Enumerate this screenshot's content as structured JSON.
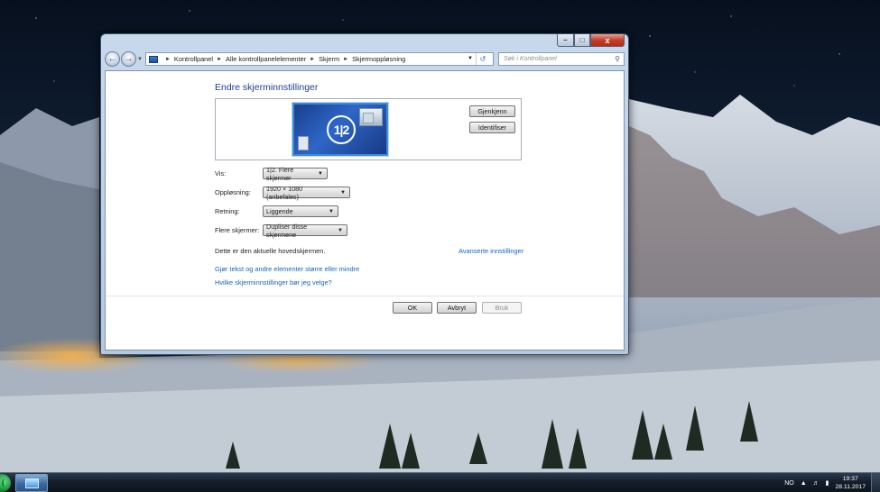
{
  "window": {
    "minimize": "–",
    "maximize": "□",
    "close": "x"
  },
  "address_bar": {
    "crumbs": [
      "Kontrollpanel",
      "Alle kontrollpanelelementer",
      "Skjerm",
      "Skjermoppløsning"
    ],
    "search_placeholder": "Søk i Kontrollpanel"
  },
  "page": {
    "title": "Endre skjerminnstillinger",
    "monitor_label": "1|2",
    "identify_buttons": {
      "detect": "Gjenkjenn",
      "identify": "Identifiser"
    },
    "settings": [
      {
        "label": "Vis:",
        "value": "1|2. Flere skjermer"
      },
      {
        "label": "Oppløsning:",
        "value": "1920 × 1080 (anbefales)"
      },
      {
        "label": "Retning:",
        "value": "Liggende"
      },
      {
        "label": "Flere skjermer:",
        "value": "Dupliser disse skjermene"
      }
    ],
    "main_display_text": "Dette er den aktuelle hovedskjermen.",
    "advanced_link": "Avanserte innstillinger",
    "links": [
      "Gjør tekst og andre elementer større eller mindre",
      "Hvilke skjerminnstillinger bør jeg velge?"
    ],
    "buttons": {
      "ok": "OK",
      "cancel": "Avbryt",
      "apply": "Bruk"
    }
  },
  "taskbar": {
    "language": "NO",
    "time": "19:37",
    "date": "28.11.2017"
  },
  "colors": {
    "link": "#1465c0",
    "heading": "#1e3f91",
    "monitor_blue": "#2e66c7",
    "close_red": "#c4402b"
  }
}
